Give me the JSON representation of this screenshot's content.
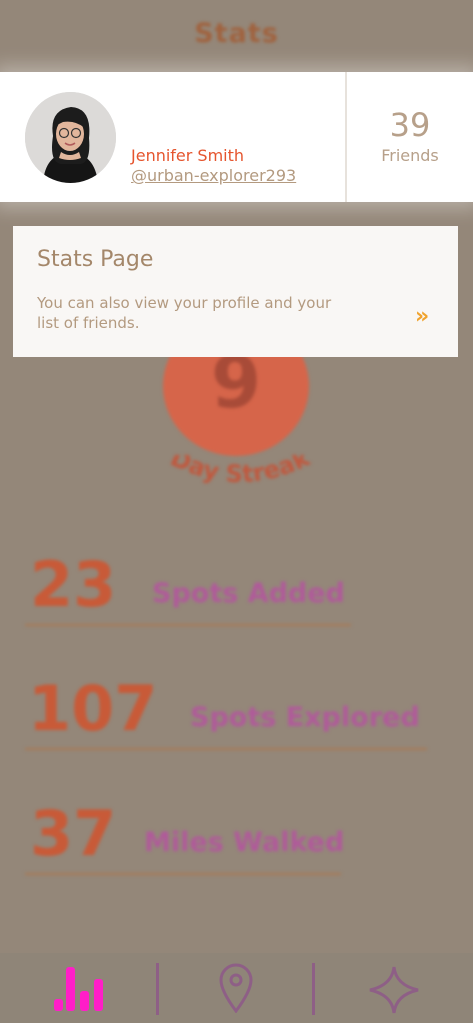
{
  "header": {
    "title": "Stats"
  },
  "profile": {
    "name": "Jennifer Smith",
    "handle": "@urban-explorer293",
    "friends_count": "39",
    "friends_label": "Friends"
  },
  "tooltip": {
    "title": "Stats Page",
    "body": "You can also view your profile and your list of friends.",
    "next_icon": "double-chevron-right-icon",
    "accent": "#f0a32e"
  },
  "streak": {
    "value": "9",
    "label": "Day Streak"
  },
  "stats": [
    {
      "value": "23",
      "label": "Spots Added"
    },
    {
      "value": "107",
      "label": "Spots Explored"
    },
    {
      "value": "37",
      "label": "Miles Walked"
    }
  ],
  "nav": {
    "items": [
      {
        "icon": "stats-icon",
        "active": true
      },
      {
        "icon": "map-pin-icon",
        "active": false
      },
      {
        "icon": "sparkle-icon",
        "active": false
      }
    ],
    "active_color": "#ff1ec8"
  }
}
